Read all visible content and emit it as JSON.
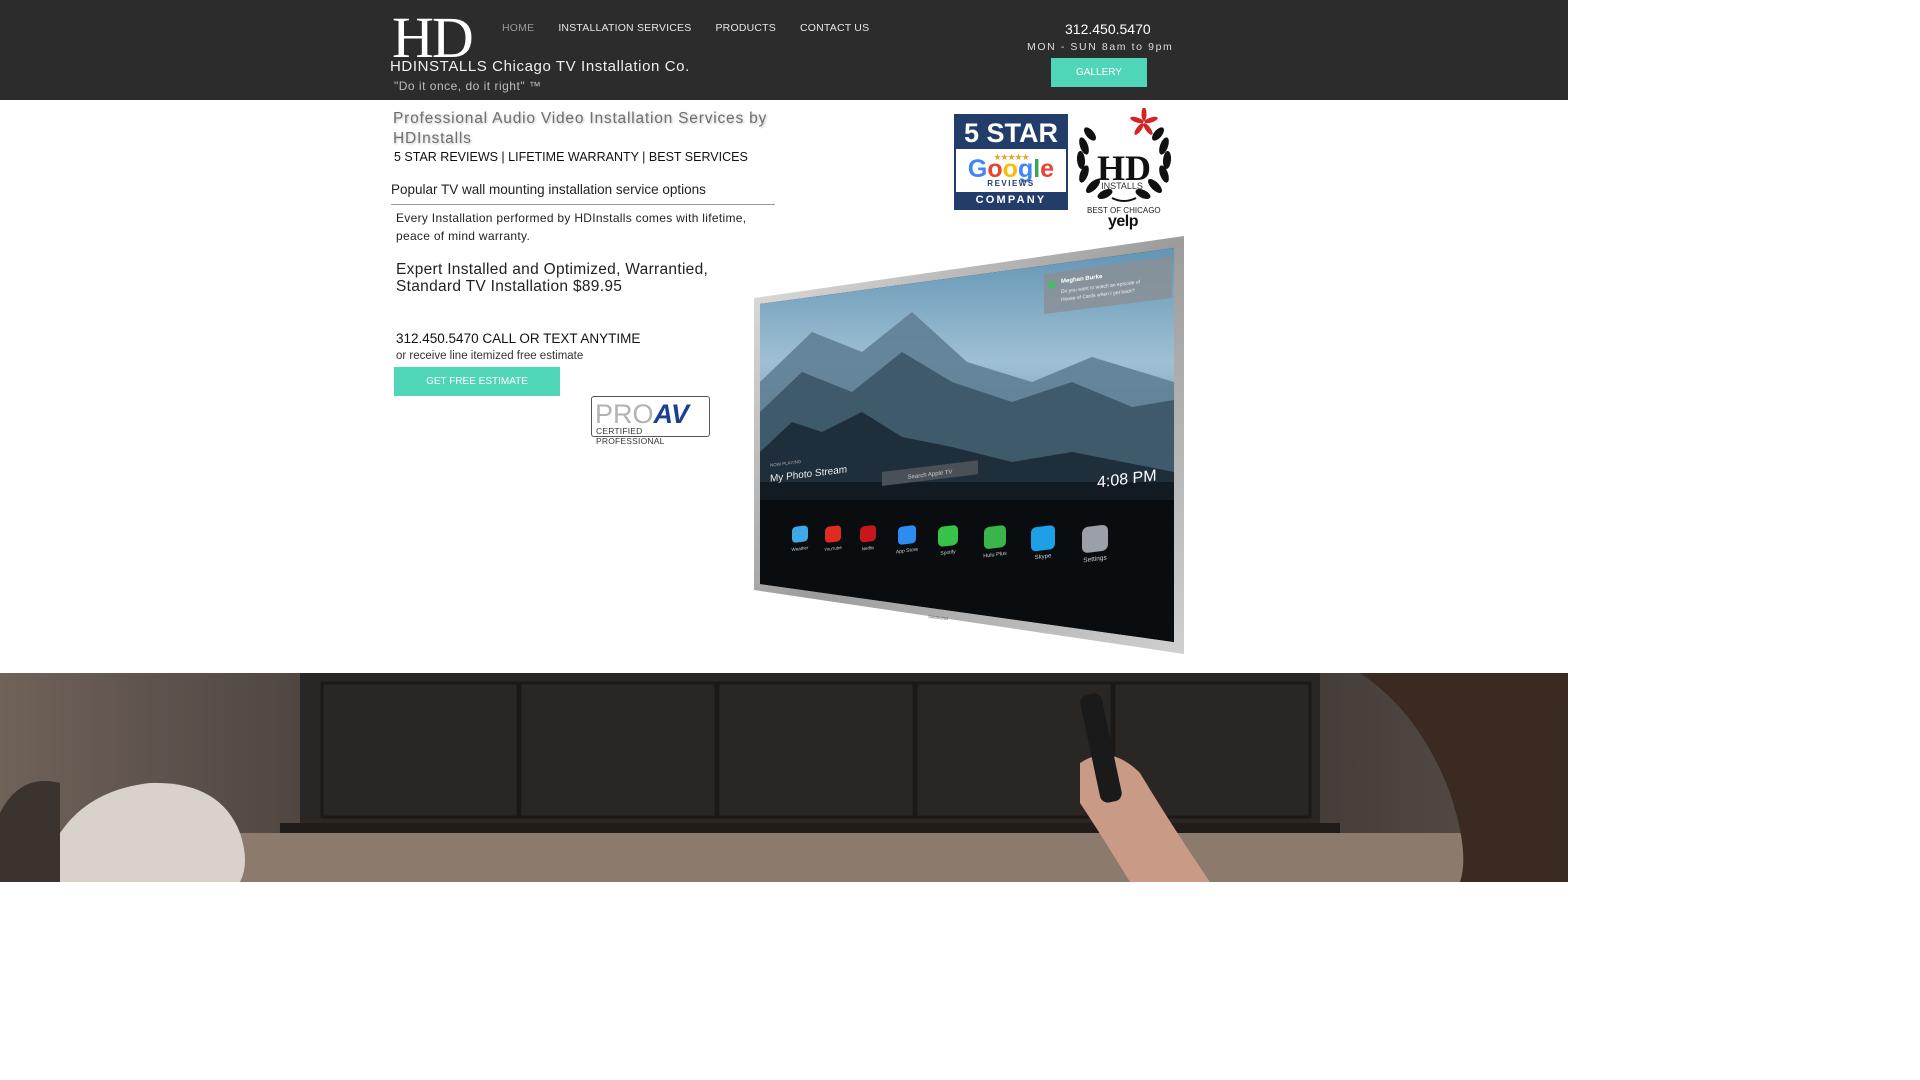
{
  "header": {
    "logo": "HD",
    "brand": "HDINSTALLS Chicago TV Installation Co.",
    "tagline": "\"Do it once, do it right\" ™",
    "nav": [
      {
        "label": "HOME",
        "active": true
      },
      {
        "label": "INSTALLATION SERVICES",
        "active": false
      },
      {
        "label": "PRODUCTS",
        "active": false
      },
      {
        "label": "CONTACT US",
        "active": false
      }
    ],
    "phone": "312.450.5470",
    "hours": "MON - SUN 8am to 9pm",
    "gallery_label": "GALLERY"
  },
  "main": {
    "title": "Professional Audio Video Installation Services by HDInstalls",
    "reviews_line": "5 STAR REVIEWS | LIFETIME WARRANTY | BEST SERVICES",
    "popular": "Popular TV wall mounting installation service options",
    "warranty_text": "Every Installation performed by HDInstalls comes with lifetime, peace of mind warranty.",
    "expert": "Expert Installed and Optimized, Warrantied, Standard TV Installation $89.95",
    "call_line": "312.450.5470 CALL OR TEXT ANYTIME",
    "receive": "or receive line itemized free estimate",
    "estimate_label": "GET FREE ESTIMATE"
  },
  "proav": {
    "pro": "PRO",
    "av": "AV",
    "certified": "CERTIFIED PROFESSIONAL"
  },
  "badge_google": {
    "top": "5 STAR",
    "stars": "★★★★★",
    "google": "Google",
    "reviews": "REVIEWS",
    "bottom": "COMPANY"
  },
  "badge_yelp": {
    "logo": "HD",
    "installs": "INSTALLS",
    "best": "BEST OF CHICAGO",
    "yelp": "yelp"
  },
  "tv_screen": {
    "notification_name": "Meghan Burke",
    "notification_text": "Do you want to watch an episode of House of Cards when I get back?",
    "now_playing": "NOW PLAYING",
    "stream": "My Photo Stream",
    "search": "Search Apple TV",
    "time": "4:08 PM",
    "apps": [
      "Weather",
      "YouTube",
      "Netflix",
      "App Store",
      "Spotify",
      "Hulu Plus",
      "Skype",
      "Settings"
    ],
    "brand": "SAMSUNG"
  },
  "colors": {
    "accent": "#4fd6b8",
    "header_bg": "#2c2c2c",
    "badge_navy": "#233d6a",
    "yelp_red": "#d32323"
  }
}
